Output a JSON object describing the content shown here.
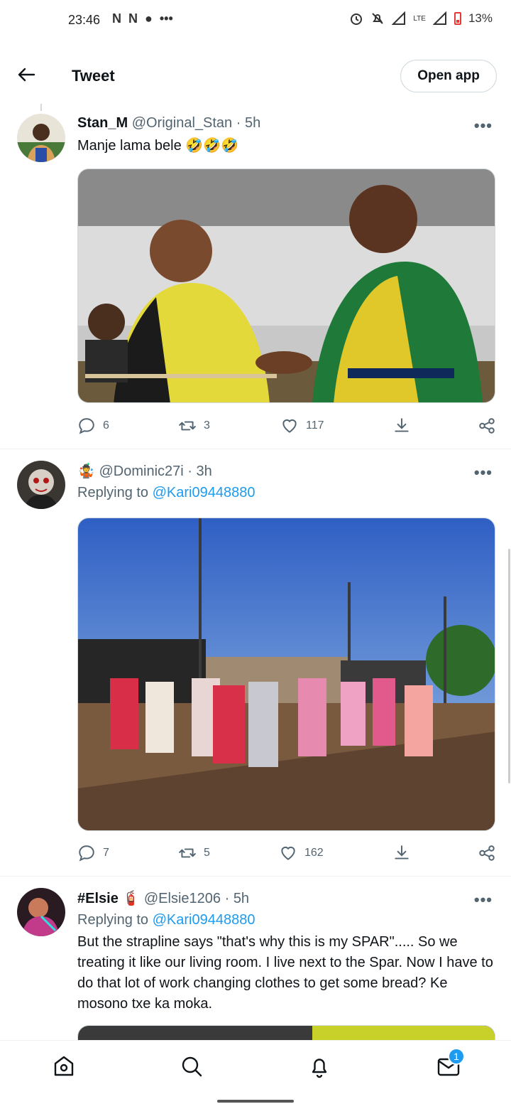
{
  "status_bar": {
    "time": "23:46",
    "left_icons": [
      "N",
      "N"
    ],
    "dots": "•••",
    "lte": "LTE",
    "battery": "13%"
  },
  "header": {
    "title": "Tweet",
    "open_app": "Open app"
  },
  "tweets": [
    {
      "name": "Stan_M",
      "handle": "@Original_Stan",
      "sep": "·",
      "time": "5h",
      "text": "Manje lama bele 🤣🤣🤣",
      "media_desc": "",
      "counts": {
        "reply": "6",
        "retweet": "3",
        "like": "117"
      }
    },
    {
      "name": "",
      "emoji": "🤹",
      "handle": "@Dominic27i",
      "sep": "·",
      "time": "3h",
      "replying_label": "Replying to",
      "replying_to": "@Kari09448880",
      "counts": {
        "reply": "7",
        "retweet": "5",
        "like": "162"
      }
    },
    {
      "name": "#Elsie",
      "emoji": "🧯",
      "handle": "@Elsie1206",
      "sep": "·",
      "time": "5h",
      "replying_label": "Replying to",
      "replying_to": "@Kari09448880",
      "text": "But the strapline says \"that's why this is my SPAR\"..... So we treating it like our living room. I live next to the Spar. Now I have to do that lot of work changing clothes to get some bread? Ke mosono txe ka moka."
    }
  ],
  "more_label": "•••",
  "bottom_nav": {
    "badge": "1"
  },
  "colors": {
    "link": "#1d9bf0",
    "muted": "#536471",
    "text": "#0f1419"
  }
}
